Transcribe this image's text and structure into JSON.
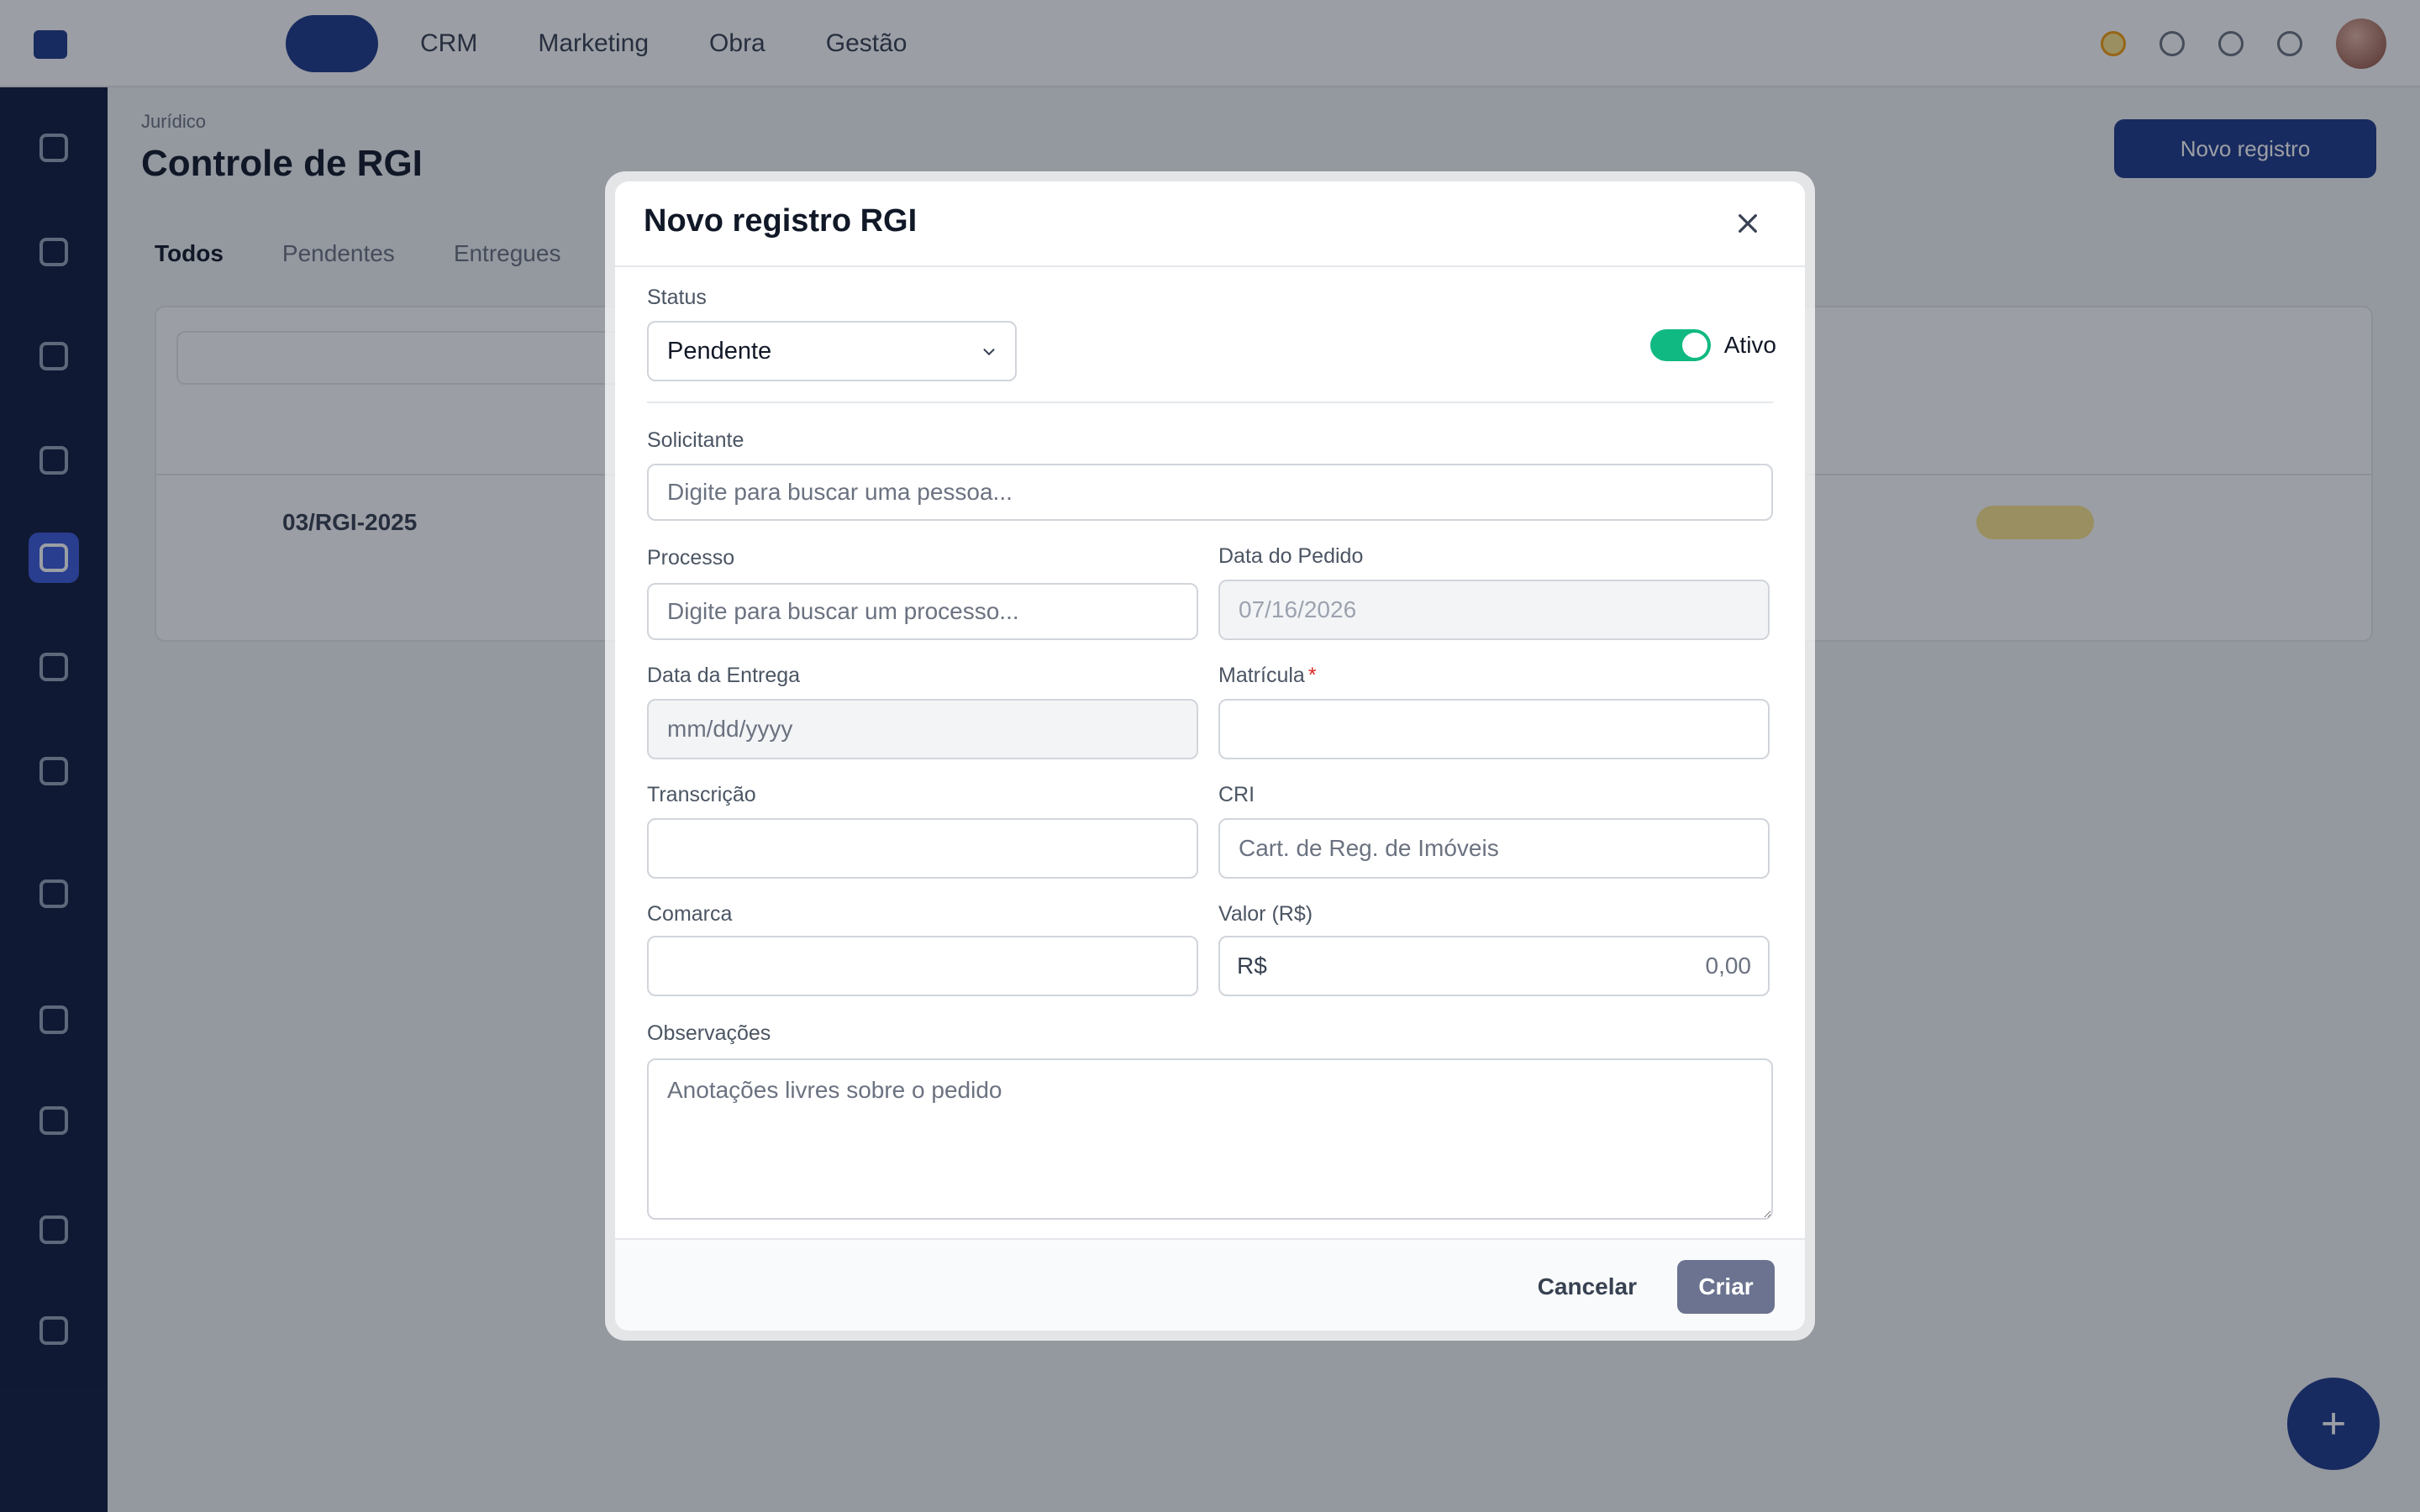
{
  "app": {
    "nav": [
      "",
      "CRM",
      "Marketing",
      "Obra",
      "Gestão"
    ],
    "breadcrumb": "Jurídico",
    "page_title": "Controle de RGI",
    "new_button": "Novo registro",
    "tabs": [
      "Todos",
      "Pendentes",
      "Entregues"
    ],
    "row_id": "03/RGI-2025",
    "icons": [
      "bell-icon",
      "grid-icon",
      "help-icon",
      "settings-icon"
    ]
  },
  "modal": {
    "title": "Novo registro RGI",
    "status_label": "Status",
    "status_value": "Pendente",
    "active_label": "Ativo",
    "active": true,
    "solicitante_label": "Solicitante",
    "solicitante_placeholder": "Digite para buscar uma pessoa...",
    "processo_label": "Processo",
    "processo_placeholder": "Digite para buscar um processo...",
    "data_pedido_label": "Data do Pedido",
    "data_pedido_value": "07/16/2026",
    "data_entrega_label": "Data da Entrega",
    "data_entrega_placeholder": "mm/dd/yyyy",
    "matricula_label": "Matrícula",
    "matricula_required": "*",
    "transcricao_label": "Transcrição",
    "cri_label": "CRI",
    "cri_placeholder": "Cart. de Reg. de Imóveis",
    "comarca_label": "Comarca",
    "valor_label": "Valor (R$)",
    "valor_prefix": "R$",
    "valor_placeholder": "0,00",
    "observacoes_label": "Observações",
    "observacoes_placeholder": "Anotações livres sobre o pedido",
    "cancel_label": "Cancelar",
    "create_label": "Criar"
  },
  "colors": {
    "primary": "#1e3a8a",
    "toggle_on": "#10b981",
    "create_button": "#6b7390",
    "required": "#dc2626"
  }
}
